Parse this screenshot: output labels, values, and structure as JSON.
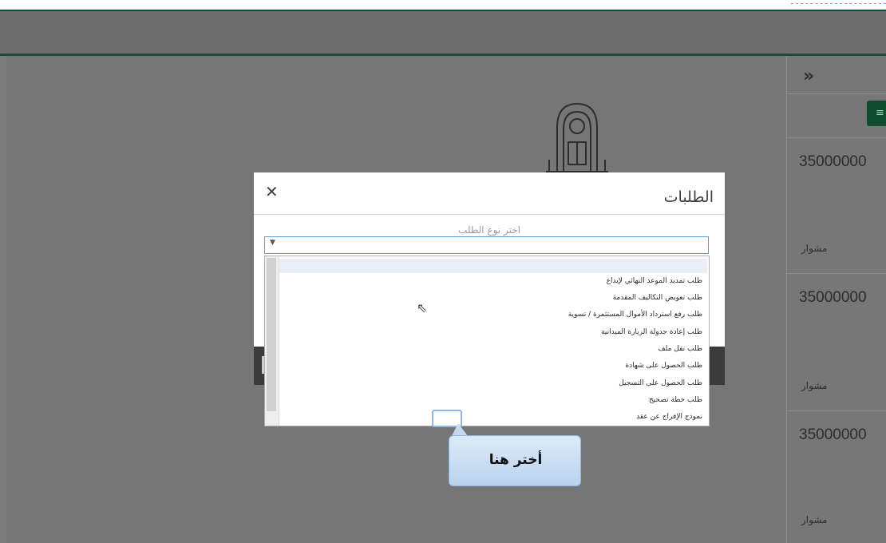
{
  "topbar": {
    "text": "ـ ـ ـ ـ ـ ـ  ـ ـ ـ ـ ـ  ـ ـ ـ ـ ـ  ـ ـ ـ ـ"
  },
  "sidebar": {
    "collapse_label": "»",
    "filter_icon": "filter-icon",
    "cards": [
      {
        "number": "35000000",
        "label": "مشوار"
      },
      {
        "number": "35000000",
        "label": "مشوار"
      },
      {
        "number": "35000000",
        "label": "مشوار"
      }
    ]
  },
  "modal": {
    "title": "الطلبات",
    "close_label": "✕",
    "field_label": "اختر نوع الطلب",
    "select_value": "",
    "options": [
      "طلب تمديد الموعد النهائي لإيداع",
      "طلب تعويض التكاليف المقدمة",
      "طلب رفع استرداد الأموال المستثمرة / تسوية",
      "طلب إعادة جدولة الزيارة الميدانية",
      "طلب نقل ملف",
      "طلب الحصول على شهادة",
      "طلب الحصول على التسجيل",
      "طلب خطة تصحيح",
      "نموذج الإفراج عن عقد"
    ]
  },
  "callout": {
    "text": "أختر هنا"
  },
  "colors": {
    "primary": "#0d4d2d",
    "overlay": "#777777",
    "focus": "#5b9bd5"
  }
}
